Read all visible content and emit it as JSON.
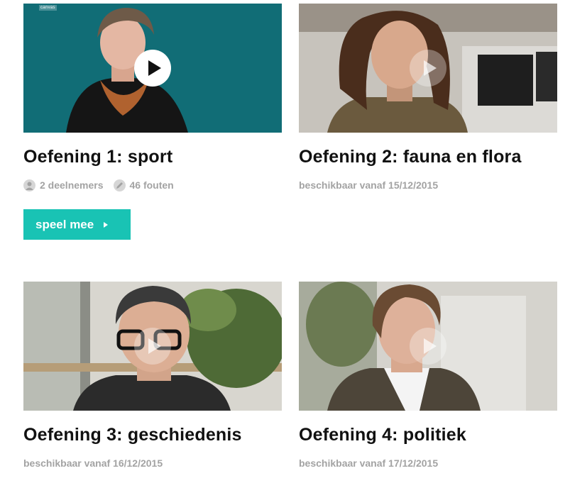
{
  "exercises": [
    {
      "title": "Oefening 1: sport",
      "participants": "2 deelnemers",
      "errors": "46 fouten",
      "button_label": "speel mee",
      "channel_logo": "canvas",
      "play_icon": "play-icon"
    },
    {
      "title": "Oefening 2: fauna en flora",
      "availability": "beschikbaar vanaf 15/12/2015",
      "play_icon": "play-icon"
    },
    {
      "title": "Oefening 3: geschiedenis",
      "availability": "beschikbaar vanaf 16/12/2015",
      "play_icon": "play-icon"
    },
    {
      "title": "Oefening 4: politiek",
      "availability": "beschikbaar vanaf 17/12/2015",
      "play_icon": "play-icon"
    }
  ],
  "colors": {
    "accent": "#19c3b4",
    "meta_text": "#a3a3a3",
    "title_text": "#111111"
  }
}
